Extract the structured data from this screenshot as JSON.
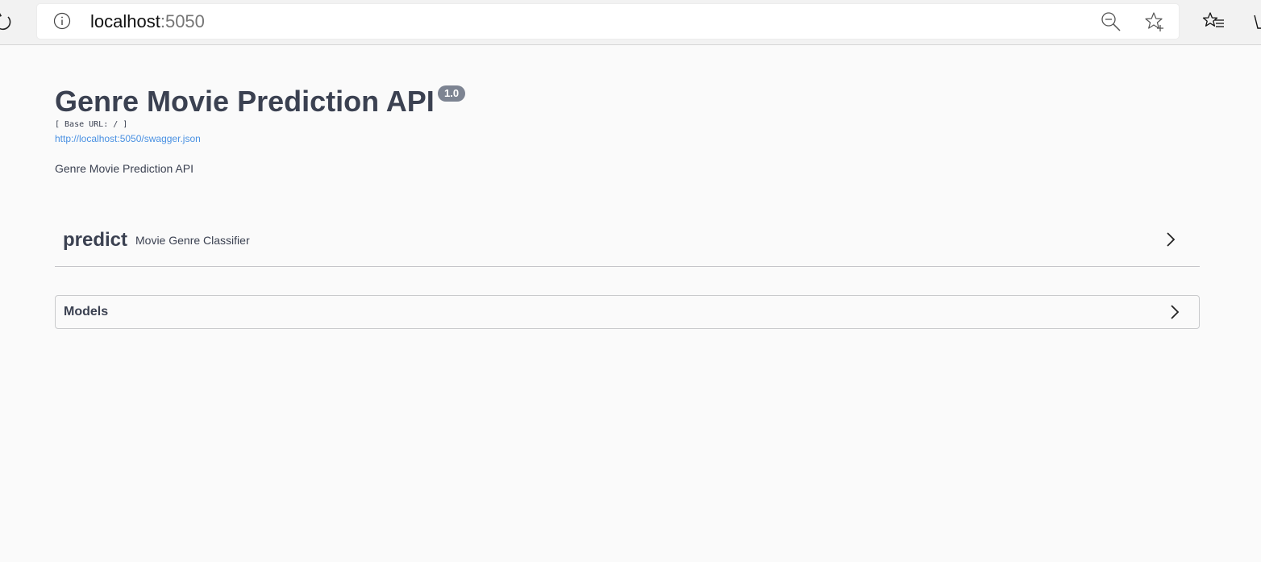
{
  "browser": {
    "url_host": "localhost",
    "url_port": ":5050",
    "icons": [
      "refresh-icon",
      "info-icon",
      "zoom-out-icon",
      "add-favorite-icon",
      "favorites-icon"
    ]
  },
  "api": {
    "title": "Genre Movie Prediction API",
    "version": "1.0",
    "base_url": "[ Base URL: / ]",
    "spec_link": "http://localhost:5050/swagger.json",
    "description": "Genre Movie Prediction API"
  },
  "tags": [
    {
      "name": "predict",
      "description": "Movie Genre Classifier"
    }
  ],
  "models": {
    "title": "Models"
  },
  "colors": {
    "text": "#3b4151",
    "link": "#4990e2",
    "badge": "#7d8492",
    "background": "#fafafa"
  }
}
